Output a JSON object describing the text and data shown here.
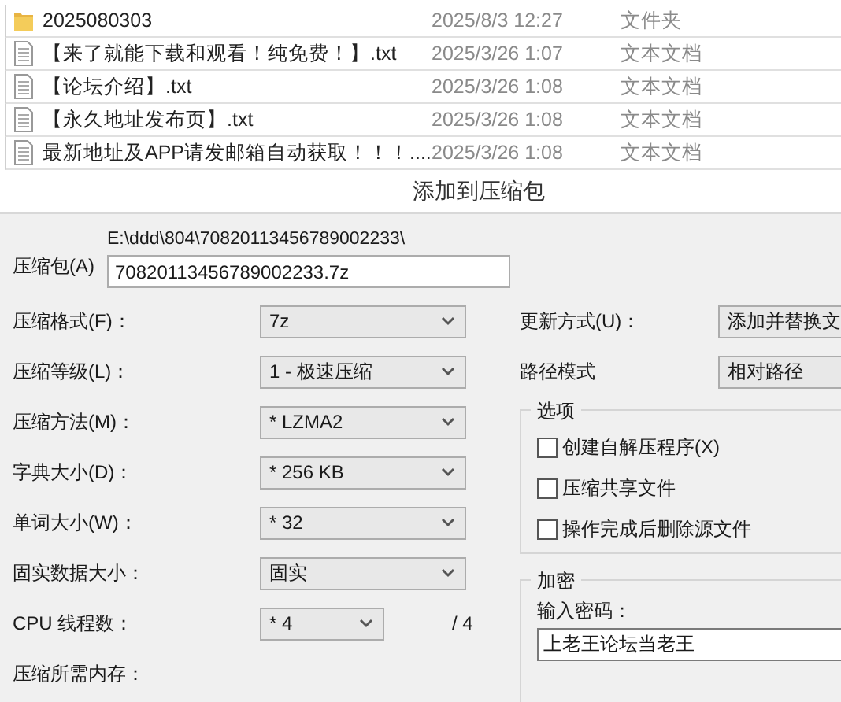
{
  "files": [
    {
      "kind": "folder",
      "name": "2025080303",
      "date": "2025/8/3 12:27",
      "type": "文件夹"
    },
    {
      "kind": "text",
      "name": "【来了就能下载和观看！纯免费！】.txt",
      "date": "2025/3/26 1:07",
      "type": "文本文档"
    },
    {
      "kind": "text",
      "name": "【论坛介绍】.txt",
      "date": "2025/3/26 1:08",
      "type": "文本文档"
    },
    {
      "kind": "text",
      "name": "【永久地址发布页】.txt",
      "date": "2025/3/26 1:08",
      "type": "文本文档"
    },
    {
      "kind": "text",
      "name": "最新地址及APP请发邮箱自动获取！！！....",
      "date": "2025/3/26 1:08",
      "type": "文本文档"
    }
  ],
  "dialog": {
    "title": "添加到压缩包",
    "archive": {
      "label": "压缩包(A)",
      "path": "E:\\ddd\\804\\70820113456789002233\\",
      "value": "70820113456789002233.7z"
    },
    "fields": [
      {
        "kind": "select",
        "label": "压缩格式(F)：",
        "value": "7z"
      },
      {
        "kind": "select",
        "label": "压缩等级(L)：",
        "value": "1 - 极速压缩"
      },
      {
        "kind": "select",
        "label": "压缩方法(M)：",
        "value": "* LZMA2"
      },
      {
        "kind": "select",
        "label": "字典大小(D)：",
        "value": "* 256 KB"
      },
      {
        "kind": "select",
        "label": "单词大小(W)：",
        "value": "* 32"
      },
      {
        "kind": "select",
        "label": "固实数据大小：",
        "value": "固实"
      },
      {
        "kind": "short-select",
        "label": "CPU 线程数：",
        "value": "* 4",
        "suffix": "/ 4"
      },
      {
        "kind": "label",
        "label": "压缩所需内存："
      }
    ],
    "update": {
      "label": "更新方式(U)：",
      "value": "添加并替换文"
    },
    "path_mode": {
      "label": "路径模式",
      "value": "相对路径"
    },
    "options": {
      "title": "选项",
      "items": [
        {
          "label": "创建自解压程序(X)",
          "checked": false
        },
        {
          "label": "压缩共享文件",
          "checked": false
        },
        {
          "label": "操作完成后删除源文件",
          "checked": false
        }
      ]
    },
    "encryption": {
      "title": "加密",
      "password_label": "输入密码：",
      "password_value": "上老王论坛当老王"
    }
  }
}
